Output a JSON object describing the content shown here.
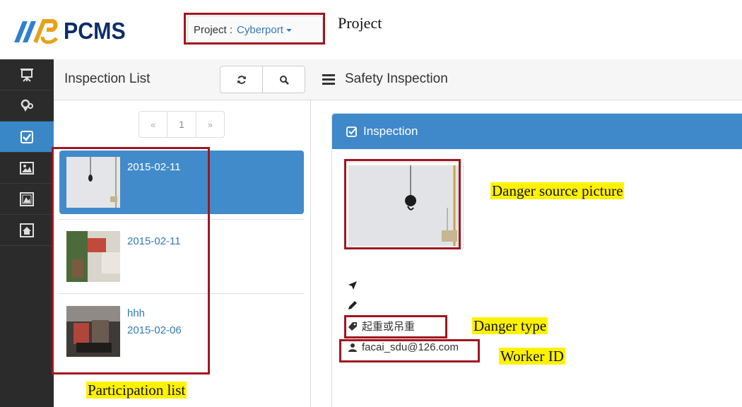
{
  "header": {
    "app_name": "PCMS",
    "project_label": "Project :",
    "project_value": "Cyberport"
  },
  "toolbar": {
    "list_title": "Inspection List",
    "section_title": "Safety Inspection"
  },
  "pager": {
    "prev": "«",
    "page": "1",
    "next": "»"
  },
  "inspection_list": [
    {
      "title": "",
      "date": "2015-02-11",
      "selected": true
    },
    {
      "title": "",
      "date": "2015-02-11",
      "selected": false
    },
    {
      "title": "hhh",
      "date": "2015-02-06",
      "selected": false
    }
  ],
  "detail": {
    "panel_title": "Inspection",
    "danger_type": "起重或吊重",
    "worker_id": "facai_sdu@126.com"
  },
  "annotations": {
    "project": "Project",
    "danger_source_picture": "Danger source picture",
    "danger_type": "Danger type",
    "worker_id": "Worker ID",
    "participation_list": "Participation list"
  },
  "colors": {
    "accent": "#3f88c9",
    "selected_item": "#428bca",
    "sidebar": "#2b2b2b",
    "annotation_box": "#a0171f",
    "annotation_highlight": "#fff200"
  }
}
